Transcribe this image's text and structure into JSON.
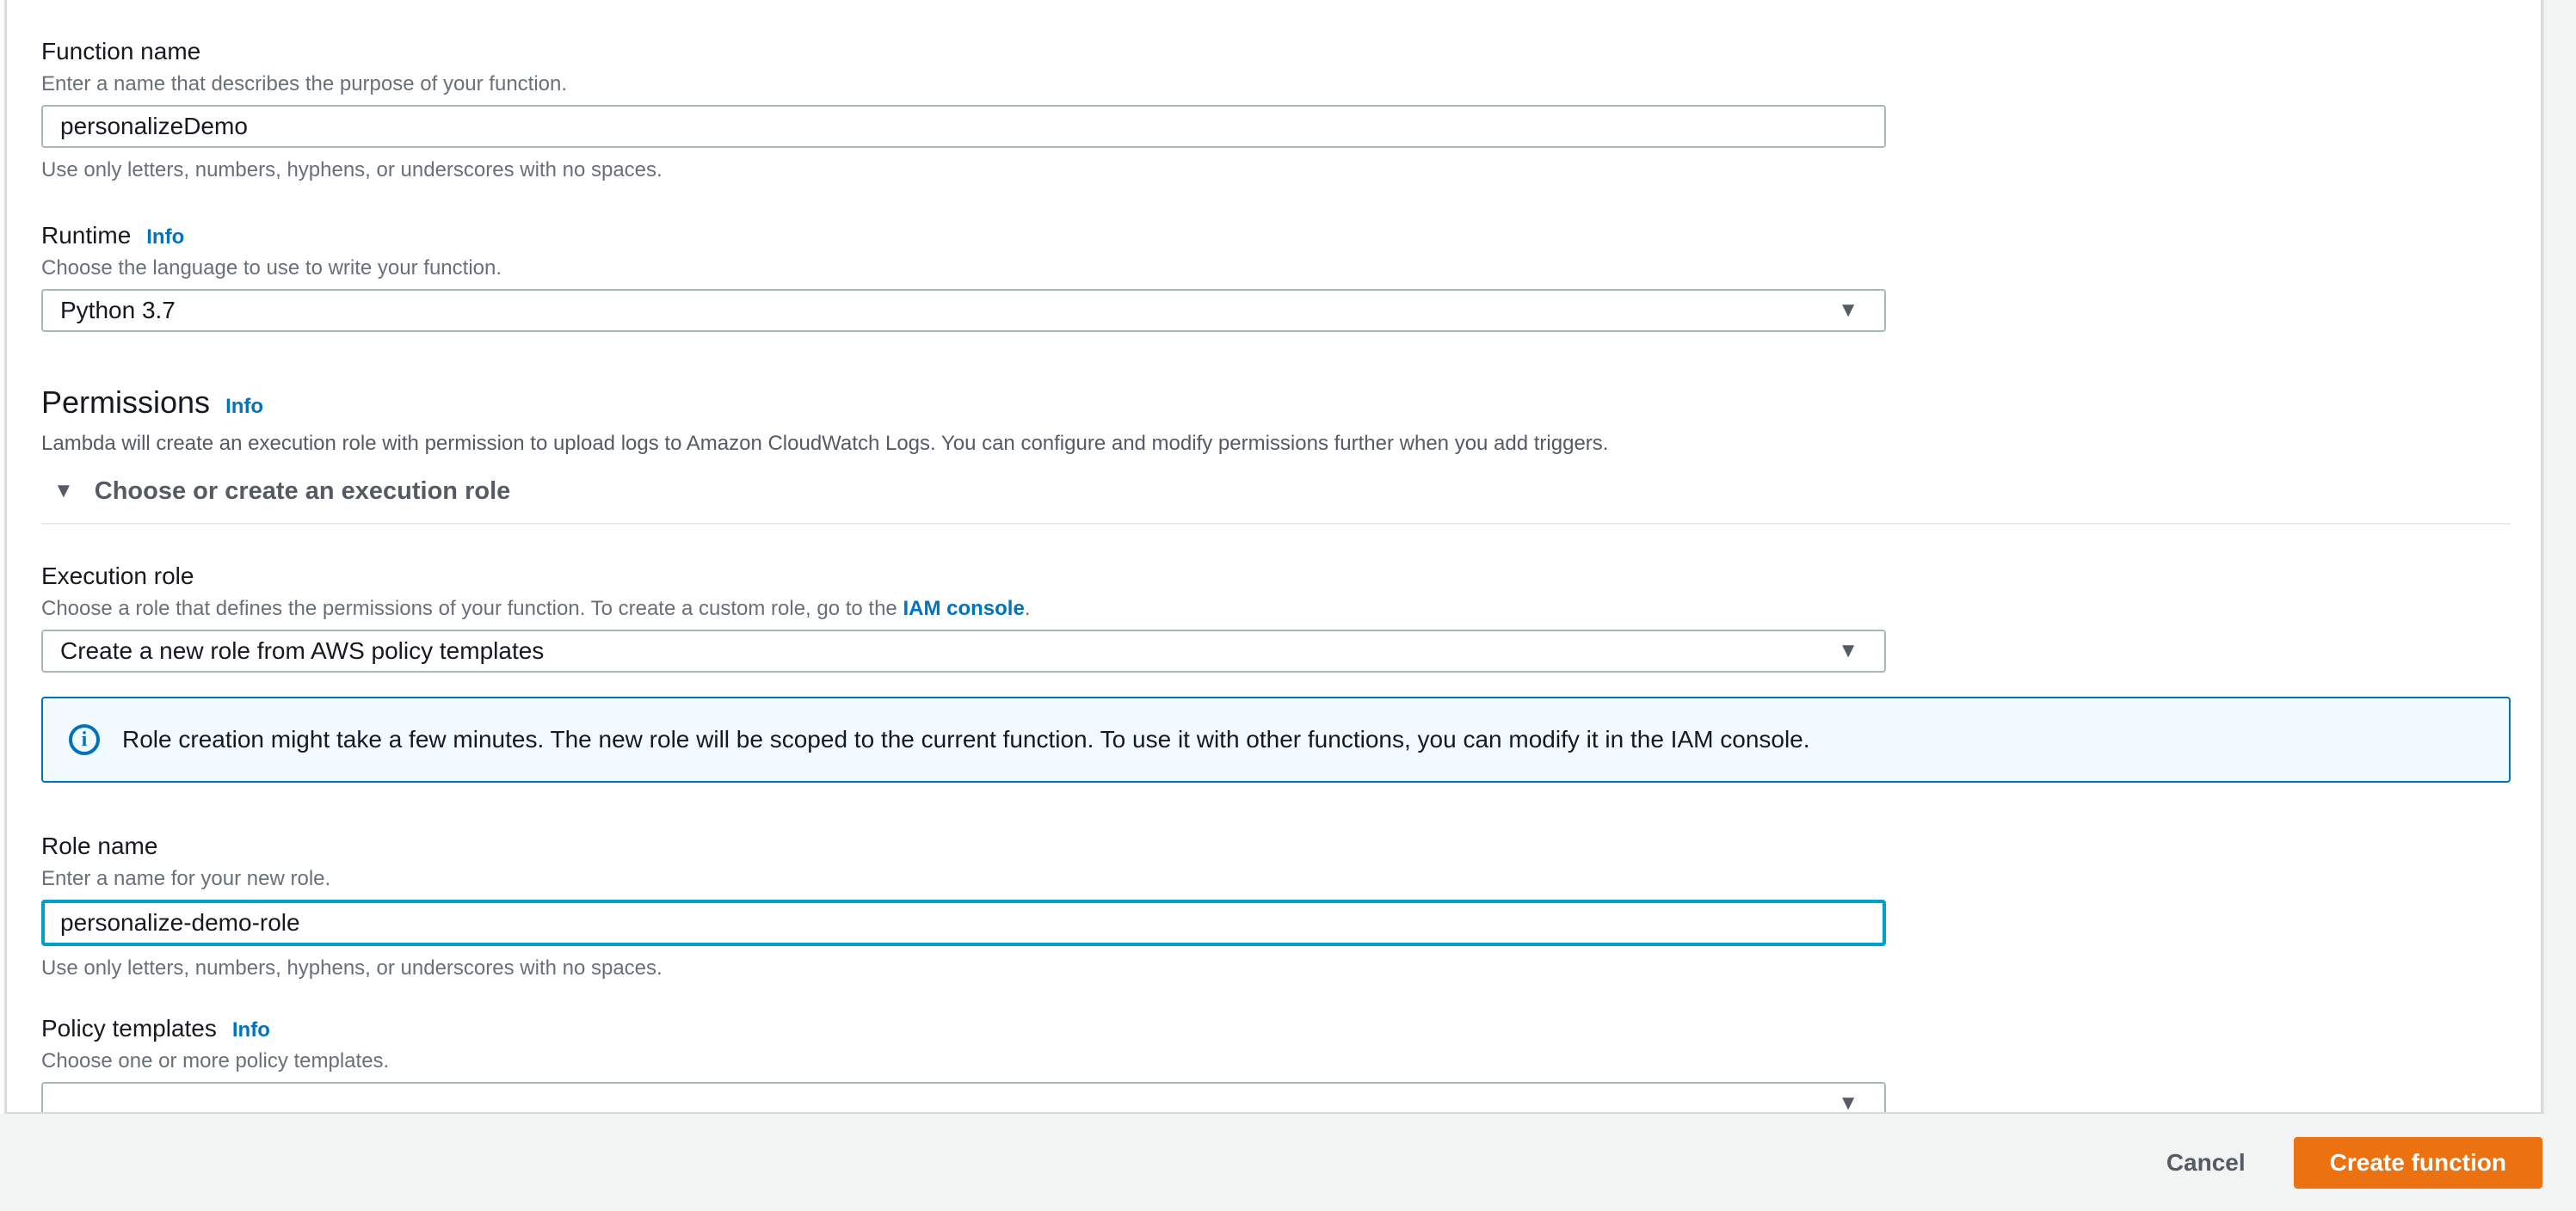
{
  "colors": {
    "link_blue": "#0073bb",
    "focus_blue": "#00a1c9",
    "primary_orange": "#ec7211",
    "text_dark": "#16191f",
    "text_secondary": "#687078",
    "alert_bg": "#f1faff",
    "page_bg_gray": "#f2f3f3"
  },
  "icons": {
    "dropdown_caret": "▼",
    "expander_triangle": "▼",
    "info_circle_glyph": "i"
  },
  "form": {
    "function_name": {
      "label": "Function name",
      "description": "Enter a name that describes the purpose of your function.",
      "value": "personalizeDemo",
      "hint": "Use only letters, numbers, hyphens, or underscores with no spaces."
    },
    "runtime": {
      "label": "Runtime",
      "info_label": "Info",
      "description": "Choose the language to use to write your function.",
      "value": "Python 3.7"
    },
    "permissions": {
      "heading": "Permissions",
      "info_label": "Info",
      "description": "Lambda will create an execution role with permission to upload logs to Amazon CloudWatch Logs. You can configure and modify permissions further when you add triggers.",
      "expander_label": "Choose or create an execution role"
    },
    "execution_role": {
      "label": "Execution role",
      "description_prefix": "Choose a role that defines the permissions of your function. To create a custom role, go to the ",
      "link_text": "IAM console",
      "description_suffix": ".",
      "value": "Create a new role from AWS policy templates"
    },
    "alert": {
      "text": "Role creation might take a few minutes. The new role will be scoped to the current function. To use it with other functions, you can modify it in the IAM console."
    },
    "role_name": {
      "label": "Role name",
      "description": "Enter a name for your new role.",
      "value": "personalize-demo-role",
      "hint": "Use only letters, numbers, hyphens, or underscores with no spaces."
    },
    "policy_templates": {
      "label": "Policy templates",
      "info_label": "Info",
      "description": "Choose one or more policy templates.",
      "value": ""
    }
  },
  "footer": {
    "cancel_label": "Cancel",
    "create_label": "Create function"
  }
}
